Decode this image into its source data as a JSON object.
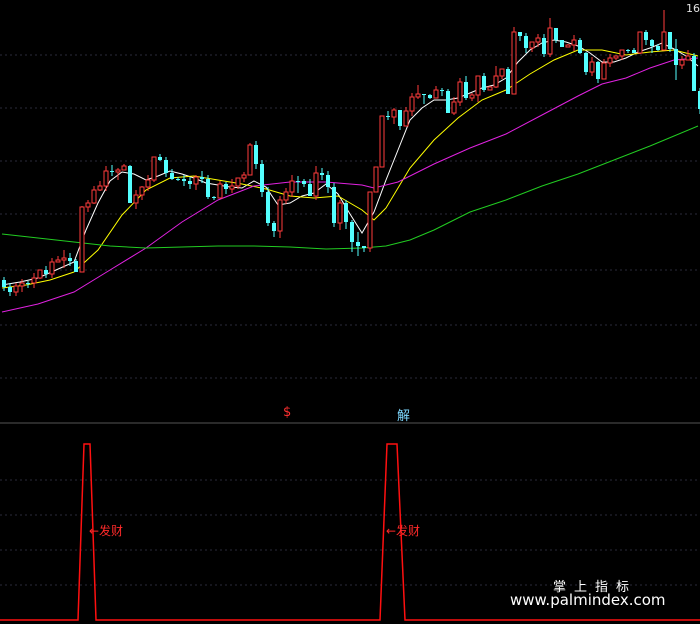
{
  "chart_data": {
    "type": "candlestick",
    "candles": [
      [
        0,
        280.0,
        287.0,
        291.0,
        277.0
      ],
      [
        1,
        287.0,
        292.0,
        296.0,
        283.0
      ],
      [
        2,
        292.0,
        286.0,
        296.0,
        283.0
      ],
      [
        3,
        286.0,
        283.0,
        292.0,
        279.0
      ],
      [
        4,
        283.0,
        283.0,
        288.0,
        281.0
      ],
      [
        5,
        283.0,
        278.0,
        288.0,
        273.0
      ],
      [
        6,
        278.0,
        270.0,
        279.0,
        270.0
      ],
      [
        7,
        270.0,
        274.0,
        278.0,
        266.0
      ],
      [
        8,
        274.0,
        262.0,
        278.0,
        258.0
      ],
      [
        9,
        262.0,
        260.0,
        262.0,
        256.0
      ],
      [
        10,
        260.0,
        258.0,
        268.0,
        250.0
      ],
      [
        11,
        258.0,
        261.0,
        266.0,
        253.0
      ],
      [
        12,
        261.0,
        272.0,
        272.0,
        259.0
      ],
      [
        13,
        272.0,
        207.0,
        272.0,
        206.0
      ],
      [
        14,
        207.0,
        203.0,
        212.0,
        200.0
      ],
      [
        15,
        203.0,
        190.0,
        204.0,
        186.0
      ],
      [
        16,
        190.0,
        186.0,
        191.0,
        181.0
      ],
      [
        17,
        186.0,
        171.0,
        191.0,
        166.0
      ],
      [
        18,
        171.0,
        172.0,
        176.0,
        165.0
      ],
      [
        19,
        172.0,
        170.0,
        180.0,
        168.0
      ],
      [
        20,
        170.0,
        166.0,
        170.0,
        164.0
      ],
      [
        21,
        166.0,
        203.0,
        203.0,
        165.0
      ],
      [
        22,
        203.0,
        195.0,
        209.0,
        190.0
      ],
      [
        23,
        195.0,
        187.0,
        200.0,
        186.0
      ],
      [
        24,
        187.0,
        180.0,
        191.0,
        175.0
      ],
      [
        25,
        180.0,
        157.0,
        182.0,
        157.0
      ],
      [
        26,
        157.0,
        160.0,
        161.0,
        154.0
      ],
      [
        27,
        160.0,
        173.0,
        177.0,
        157.0
      ],
      [
        28,
        173.0,
        179.0,
        180.0,
        169.0
      ],
      [
        29,
        179.0,
        179.0,
        181.0,
        177.0
      ],
      [
        30,
        179.0,
        181.0,
        186.0,
        175.0
      ],
      [
        31,
        181.0,
        184.0,
        189.0,
        177.0
      ],
      [
        32,
        184.0,
        177.0,
        190.0,
        175.0
      ],
      [
        33,
        177.0,
        179.0,
        183.0,
        171.0
      ],
      [
        34,
        179.0,
        197.0,
        199.0,
        175.0
      ],
      [
        35,
        197.0,
        198.0,
        200.0,
        196.0
      ],
      [
        36,
        198.0,
        184.0,
        198.0,
        181.0
      ],
      [
        37,
        184.0,
        189.0,
        194.0,
        182.0
      ],
      [
        38,
        189.0,
        186.0,
        193.0,
        179.0
      ],
      [
        39,
        186.0,
        178.0,
        189.0,
        178.0
      ],
      [
        40,
        178.0,
        175.0,
        182.0,
        172.0
      ],
      [
        41,
        175.0,
        145.0,
        175.0,
        143.0
      ],
      [
        42,
        145.0,
        164.0,
        169.0,
        141.0
      ],
      [
        43,
        164.0,
        192.0,
        197.0,
        160.0
      ],
      [
        44,
        192.0,
        223.0,
        226.0,
        187.0
      ],
      [
        45,
        223.0,
        231.0,
        237.0,
        221.0
      ],
      [
        46,
        231.0,
        200.0,
        238.0,
        196.0
      ],
      [
        47,
        200.0,
        192.0,
        204.0,
        188.0
      ],
      [
        48,
        192.0,
        181.0,
        197.0,
        175.0
      ],
      [
        49,
        181.0,
        181.0,
        193.0,
        176.0
      ],
      [
        50,
        181.0,
        184.0,
        187.0,
        179.0
      ],
      [
        51,
        184.0,
        196.0,
        196.0,
        179.0
      ],
      [
        52,
        196.0,
        173.0,
        200.0,
        166.0
      ],
      [
        53,
        173.0,
        175.0,
        180.0,
        168.0
      ],
      [
        54,
        175.0,
        187.0,
        193.0,
        171.0
      ],
      [
        55,
        187.0,
        223.0,
        227.0,
        183.0
      ],
      [
        56,
        223.0,
        203.0,
        230.0,
        200.0
      ],
      [
        57,
        203.0,
        222.0,
        229.0,
        200.0
      ],
      [
        58,
        222.0,
        242.0,
        252.0,
        220.0
      ],
      [
        59,
        242.0,
        246.0,
        256.0,
        232.0
      ],
      [
        60,
        246.0,
        248.0,
        252.0,
        246.0
      ],
      [
        61,
        248.0,
        192.0,
        252.0,
        192.0
      ],
      [
        62,
        192.0,
        167.0,
        192.0,
        167.0
      ],
      [
        63,
        167.0,
        116.0,
        167.0,
        116.0
      ],
      [
        64,
        116.0,
        117.0,
        120.0,
        111.0
      ],
      [
        65,
        117.0,
        110.0,
        124.0,
        108.0
      ],
      [
        66,
        110.0,
        126.0,
        130.0,
        110.0
      ],
      [
        67,
        126.0,
        111.0,
        126.0,
        107.0
      ],
      [
        68,
        111.0,
        97.0,
        116.0,
        93.0
      ],
      [
        69,
        97.0,
        94.0,
        99.0,
        85.0
      ],
      [
        70,
        94.0,
        95.0,
        104.0,
        94.0
      ],
      [
        71,
        95.0,
        98.0,
        99.0,
        94.0
      ],
      [
        72,
        98.0,
        90.0,
        98.0,
        86.0
      ],
      [
        73,
        90.0,
        91.0,
        96.0,
        88.0
      ],
      [
        74,
        91.0,
        113.0,
        113.0,
        89.0
      ],
      [
        75,
        113.0,
        102.0,
        115.0,
        97.0
      ],
      [
        76,
        102.0,
        82.0,
        106.0,
        78.0
      ],
      [
        77,
        82.0,
        98.0,
        100.0,
        76.0
      ],
      [
        78,
        98.0,
        95.0,
        101.0,
        93.0
      ],
      [
        79,
        95.0,
        76.0,
        102.0,
        76.0
      ],
      [
        80,
        76.0,
        90.0,
        92.0,
        73.0
      ],
      [
        81,
        90.0,
        87.0,
        90.0,
        86.0
      ],
      [
        82,
        87.0,
        76.0,
        88.0,
        66.0
      ],
      [
        83,
        76.0,
        69.0,
        79.0,
        69.0
      ],
      [
        84,
        69.0,
        94.0,
        94.0,
        67.0
      ],
      [
        85,
        94.0,
        32.0,
        94.0,
        27.0
      ],
      [
        86,
        32.0,
        36.0,
        41.0,
        32.0
      ],
      [
        87,
        36.0,
        48.0,
        53.0,
        33.0
      ],
      [
        88,
        48.0,
        42.0,
        52.0,
        42.0
      ],
      [
        89,
        42.0,
        38.0,
        47.0,
        34.0
      ],
      [
        90,
        38.0,
        54.0,
        57.0,
        34.0
      ],
      [
        91,
        54.0,
        28.0,
        57.0,
        18.0
      ],
      [
        92,
        28.0,
        40.0,
        43.0,
        28.0
      ],
      [
        93,
        40.0,
        47.0,
        47.0,
        40.0
      ],
      [
        94,
        47.0,
        45.0,
        47.0,
        44.0
      ],
      [
        95,
        45.0,
        40.0,
        51.0,
        35.0
      ],
      [
        96,
        40.0,
        53.0,
        54.0,
        38.0
      ],
      [
        97,
        53.0,
        72.0,
        75.0,
        52.0
      ],
      [
        98,
        72.0,
        62.0,
        76.0,
        57.0
      ],
      [
        99,
        62.0,
        79.0,
        83.0,
        61.0
      ],
      [
        100,
        79.0,
        63.0,
        79.0,
        59.0
      ],
      [
        101,
        63.0,
        58.0,
        67.0,
        54.0
      ],
      [
        102,
        58.0,
        56.0,
        60.0,
        56.0
      ],
      [
        103,
        56.0,
        50.0,
        60.0,
        50.0
      ],
      [
        104,
        50.0,
        50.0,
        53.0,
        49.0
      ],
      [
        105,
        50.0,
        53.0,
        53.0,
        48.0
      ],
      [
        106,
        53.0,
        32.0,
        54.0,
        32.0
      ],
      [
        107,
        32.0,
        40.0,
        45.0,
        30.0
      ],
      [
        108,
        40.0,
        46.0,
        53.0,
        39.0
      ],
      [
        109,
        46.0,
        50.0,
        51.0,
        44.0
      ],
      [
        110,
        50.0,
        32.0,
        50.0,
        10.0
      ],
      [
        111,
        32.0,
        49.0,
        52.0,
        32.0
      ],
      [
        112,
        49.0,
        65.0,
        80.0,
        39.0
      ],
      [
        113,
        65.0,
        60.0,
        69.0,
        56.0
      ],
      [
        114,
        60.0,
        56.0,
        60.0,
        50.0
      ],
      [
        115,
        56.0,
        91.0,
        91.0,
        53.0
      ],
      [
        116,
        91.0,
        109.0,
        114.0,
        88.0
      ]
    ],
    "ma": [
      {
        "color": "#ffffff",
        "values": [
          [
            0,
            285
          ],
          [
            3,
            282
          ],
          [
            6,
            278
          ],
          [
            9,
            270
          ],
          [
            12,
            262
          ],
          [
            14,
            230
          ],
          [
            16,
            203
          ],
          [
            18,
            181
          ],
          [
            20,
            172
          ],
          [
            22,
            174
          ],
          [
            24,
            180
          ],
          [
            26,
            176
          ],
          [
            28,
            171
          ],
          [
            30,
            174
          ],
          [
            32,
            178
          ],
          [
            34,
            183
          ],
          [
            36,
            185
          ],
          [
            38,
            187
          ],
          [
            40,
            188
          ],
          [
            42,
            181
          ],
          [
            44,
            187
          ],
          [
            46,
            205
          ],
          [
            48,
            203
          ],
          [
            50,
            196
          ],
          [
            52,
            193
          ],
          [
            54,
            184
          ],
          [
            56,
            194
          ],
          [
            58,
            214
          ],
          [
            60,
            233
          ],
          [
            62,
            212
          ],
          [
            64,
            180
          ],
          [
            66,
            150
          ],
          [
            68,
            120
          ],
          [
            70,
            108
          ],
          [
            72,
            100
          ],
          [
            74,
            100
          ],
          [
            76,
            98
          ],
          [
            78,
            93
          ],
          [
            80,
            88
          ],
          [
            82,
            85
          ],
          [
            84,
            78
          ],
          [
            86,
            62
          ],
          [
            88,
            50
          ],
          [
            90,
            43
          ],
          [
            92,
            40
          ],
          [
            94,
            42
          ],
          [
            96,
            46
          ],
          [
            98,
            53
          ],
          [
            100,
            62
          ],
          [
            102,
            62
          ],
          [
            104,
            58
          ],
          [
            106,
            52
          ],
          [
            108,
            48
          ],
          [
            110,
            43
          ],
          [
            112,
            49
          ],
          [
            114,
            56
          ],
          [
            116,
            66
          ]
        ]
      },
      {
        "color": "#ffff00",
        "values": [
          [
            0,
            288
          ],
          [
            4,
            285
          ],
          [
            8,
            280
          ],
          [
            12,
            272
          ],
          [
            16,
            250
          ],
          [
            20,
            215
          ],
          [
            24,
            190
          ],
          [
            28,
            178
          ],
          [
            32,
            176
          ],
          [
            36,
            180
          ],
          [
            40,
            184
          ],
          [
            44,
            189
          ],
          [
            48,
            196
          ],
          [
            52,
            198
          ],
          [
            56,
            196
          ],
          [
            60,
            210
          ],
          [
            62,
            220
          ],
          [
            64,
            208
          ],
          [
            68,
            168
          ],
          [
            72,
            140
          ],
          [
            76,
            118
          ],
          [
            80,
            100
          ],
          [
            84,
            90
          ],
          [
            88,
            74
          ],
          [
            92,
            60
          ],
          [
            96,
            50
          ],
          [
            100,
            50
          ],
          [
            104,
            55
          ],
          [
            108,
            52
          ],
          [
            112,
            50
          ],
          [
            116,
            56
          ]
        ]
      },
      {
        "color": "#e022e0",
        "values": [
          [
            0,
            312
          ],
          [
            6,
            304
          ],
          [
            12,
            292
          ],
          [
            18,
            270
          ],
          [
            24,
            248
          ],
          [
            30,
            222
          ],
          [
            36,
            200
          ],
          [
            42,
            186
          ],
          [
            48,
            182
          ],
          [
            54,
            182
          ],
          [
            60,
            185
          ],
          [
            62,
            188
          ],
          [
            66,
            182
          ],
          [
            72,
            164
          ],
          [
            78,
            148
          ],
          [
            84,
            134
          ],
          [
            90,
            115
          ],
          [
            96,
            96
          ],
          [
            100,
            84
          ],
          [
            104,
            78
          ],
          [
            108,
            68
          ],
          [
            112,
            60
          ],
          [
            116,
            58
          ]
        ]
      },
      {
        "color": "#22cc22",
        "values": [
          [
            0,
            234
          ],
          [
            6,
            238
          ],
          [
            12,
            242
          ],
          [
            18,
            246
          ],
          [
            24,
            248
          ],
          [
            30,
            247
          ],
          [
            36,
            246
          ],
          [
            42,
            246
          ],
          [
            48,
            247
          ],
          [
            54,
            249
          ],
          [
            60,
            248
          ],
          [
            64,
            246
          ],
          [
            68,
            240
          ],
          [
            72,
            230
          ],
          [
            78,
            212
          ],
          [
            84,
            200
          ],
          [
            90,
            186
          ],
          [
            96,
            174
          ],
          [
            102,
            160
          ],
          [
            108,
            146
          ],
          [
            112,
            136
          ],
          [
            116,
            126
          ]
        ]
      }
    ],
    "indicator": {
      "peaks": [
        [
          78,
          84,
          90,
          96
        ],
        [
          380,
          387,
          397,
          405
        ]
      ],
      "color": "#ff1010"
    },
    "markers": {
      "s": "$",
      "jie": "解"
    },
    "labels": {
      "fa1": "←发财",
      "fa2": "←发财",
      "price": "16"
    }
  },
  "watermark": {
    "title": "掌上指标",
    "url": "www.palmindex.com"
  }
}
